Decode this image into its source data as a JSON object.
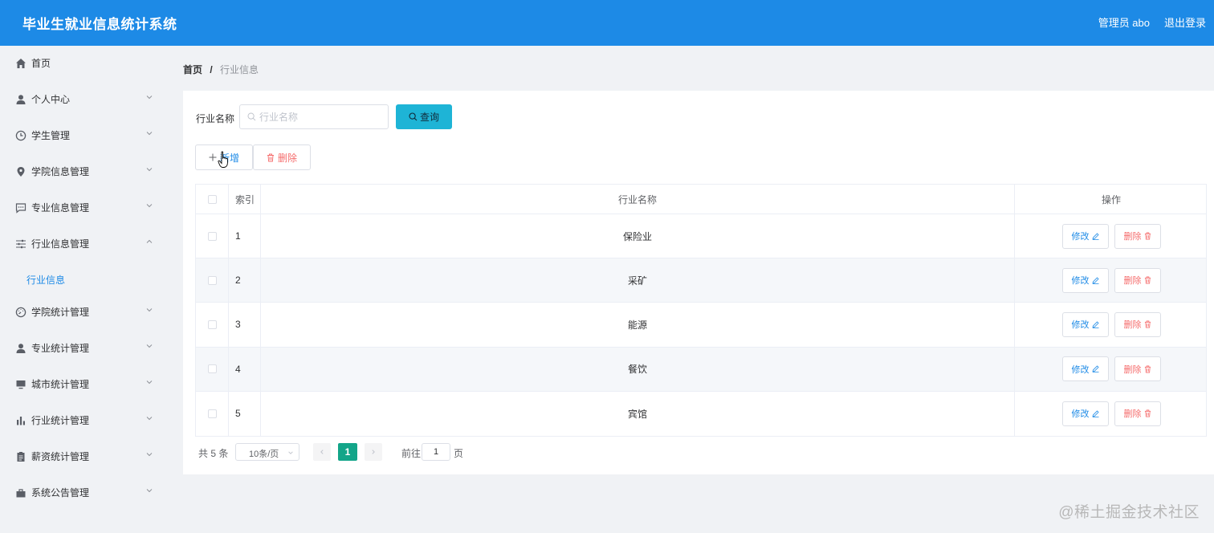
{
  "header": {
    "app_title": "毕业生就业信息统计系统",
    "user": "管理员 abo",
    "logout": "退出登录"
  },
  "sidebar": {
    "items": [
      {
        "label": "首页",
        "icon": "home-icon"
      },
      {
        "label": "个人中心",
        "icon": "user-icon"
      },
      {
        "label": "学生管理",
        "icon": "clock-icon"
      },
      {
        "label": "学院信息管理",
        "icon": "location-icon"
      },
      {
        "label": "专业信息管理",
        "icon": "chat-icon"
      },
      {
        "label": "行业信息管理",
        "icon": "sliders-icon",
        "expanded": true
      },
      {
        "label": "学院统计管理",
        "icon": "gauge-icon"
      },
      {
        "label": "专业统计管理",
        "icon": "user-icon"
      },
      {
        "label": "城市统计管理",
        "icon": "monitor-icon"
      },
      {
        "label": "行业统计管理",
        "icon": "bar-chart-icon"
      },
      {
        "label": "薪资统计管理",
        "icon": "clipboard-icon"
      },
      {
        "label": "系统公告管理",
        "icon": "briefcase-icon"
      }
    ],
    "submenu": {
      "label": "行业信息"
    }
  },
  "breadcrumb": {
    "home": "首页",
    "separator": "/",
    "current": "行业信息"
  },
  "search": {
    "label": "行业名称",
    "placeholder": "行业名称",
    "value": "",
    "button": "查询"
  },
  "actions": {
    "add": "新增",
    "delete": "删除"
  },
  "table": {
    "columns": [
      "索引",
      "行业名称",
      "操作"
    ],
    "rows": [
      {
        "index": "1",
        "name": "保险业"
      },
      {
        "index": "2",
        "name": "采矿"
      },
      {
        "index": "3",
        "name": "能源"
      },
      {
        "index": "4",
        "name": "餐饮"
      },
      {
        "index": "5",
        "name": "宾馆"
      }
    ],
    "edit_label": "修改",
    "delete_label": "删除"
  },
  "pagination": {
    "total": "共 5 条",
    "page_size": "10条/页",
    "current_page": "1",
    "goto_prefix": "前往",
    "goto_value": "1",
    "goto_suffix": "页"
  },
  "watermark": "@稀土掘金技术社区",
  "colors": {
    "header": "#1d8ae6",
    "search_button": "#1eb4d6",
    "active_page": "#13a589",
    "danger": "#f56c6c"
  }
}
